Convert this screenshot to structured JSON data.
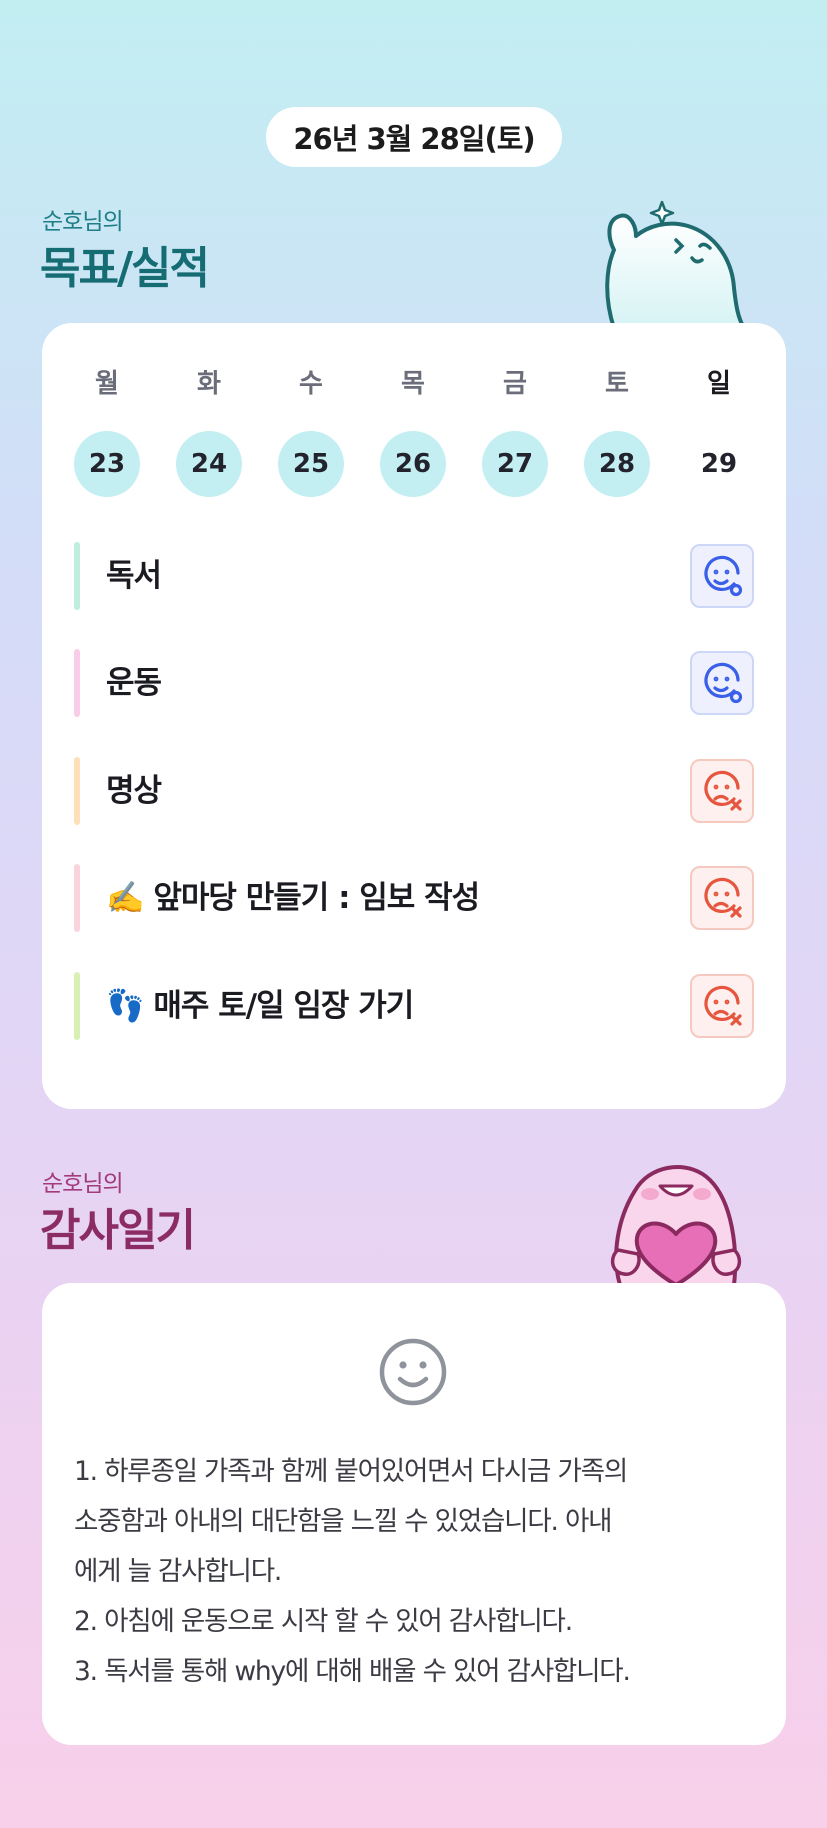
{
  "date_label": "26년 3월 28일(토)",
  "goals_section": {
    "owner": "순호님의",
    "title": "목표/실적"
  },
  "week": {
    "days": [
      "월",
      "화",
      "수",
      "목",
      "금",
      "토",
      "일"
    ],
    "dates": [
      "23",
      "24",
      "25",
      "26",
      "27",
      "28",
      "29"
    ],
    "active_count": 6
  },
  "goals": [
    {
      "label": "독서",
      "status": "done",
      "bar_color": "#bfeee0"
    },
    {
      "label": "운동",
      "status": "done",
      "bar_color": "#f9cde8"
    },
    {
      "label": "명상",
      "status": "missed",
      "bar_color": "#fde0b8"
    },
    {
      "label": "✍️ 앞마당 만들기 : 임보 작성",
      "status": "missed",
      "bar_color": "#fbd3dc"
    },
    {
      "label": "👣 매주 토/일 임장 가기",
      "status": "missed",
      "bar_color": "#d8f0b4"
    }
  ],
  "status_icons": {
    "done": "smile-check-icon",
    "missed": "sad-x-icon"
  },
  "colors": {
    "done": "#3a5fe8",
    "missed": "#e6553d",
    "active_date_bg": "#c3eff2"
  },
  "thanks_section": {
    "owner": "순호님의",
    "title": "감사일기",
    "icon": "smile-face-icon",
    "lines": [
      "1. 하루종일 가족과 함께 붙어있어면서 다시금 가족의",
      "소중함과 아내의 대단함을 느낄 수 있었습니다. 아내",
      "에게 늘 감사합니다.",
      "2. 아침에 운동으로 시작 할 수 있어 감사합니다.",
      "3. 독서를 통해 why에 대해 배울 수 있어 감사합니다."
    ]
  }
}
